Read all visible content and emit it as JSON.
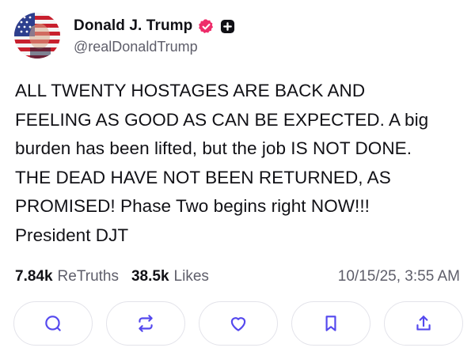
{
  "author": {
    "display_name": "Donald J. Trump",
    "handle": "@realDonaldTrump",
    "avatar_icon": "avatar-portrait-flag",
    "verified_icon": "verified-badge-icon",
    "plus_icon": "plus-badge-icon"
  },
  "post": {
    "lines": [
      "ALL TWENTY HOSTAGES ARE BACK AND",
      "FEELING AS GOOD AS CAN BE EXPECTED. A big",
      "burden has been lifted, but the job IS NOT DONE.",
      "THE DEAD HAVE NOT BEEN RETURNED, AS",
      "PROMISED! Phase Two begins right NOW!!!",
      "President DJT"
    ]
  },
  "stats": {
    "retruths_count": "7.84k",
    "retruths_label": "ReTruths",
    "likes_count": "38.5k",
    "likes_label": "Likes",
    "timestamp": "10/15/25, 3:55 AM"
  },
  "actions": [
    {
      "icon": "reply-icon"
    },
    {
      "icon": "retruth-icon"
    },
    {
      "icon": "like-icon"
    },
    {
      "icon": "bookmark-icon"
    },
    {
      "icon": "share-icon"
    }
  ],
  "colors": {
    "text": "#111116",
    "muted": "#5e5e6a",
    "accent": "#5448ee",
    "border": "#e3e3ea",
    "verified": "#ee2d6a"
  }
}
